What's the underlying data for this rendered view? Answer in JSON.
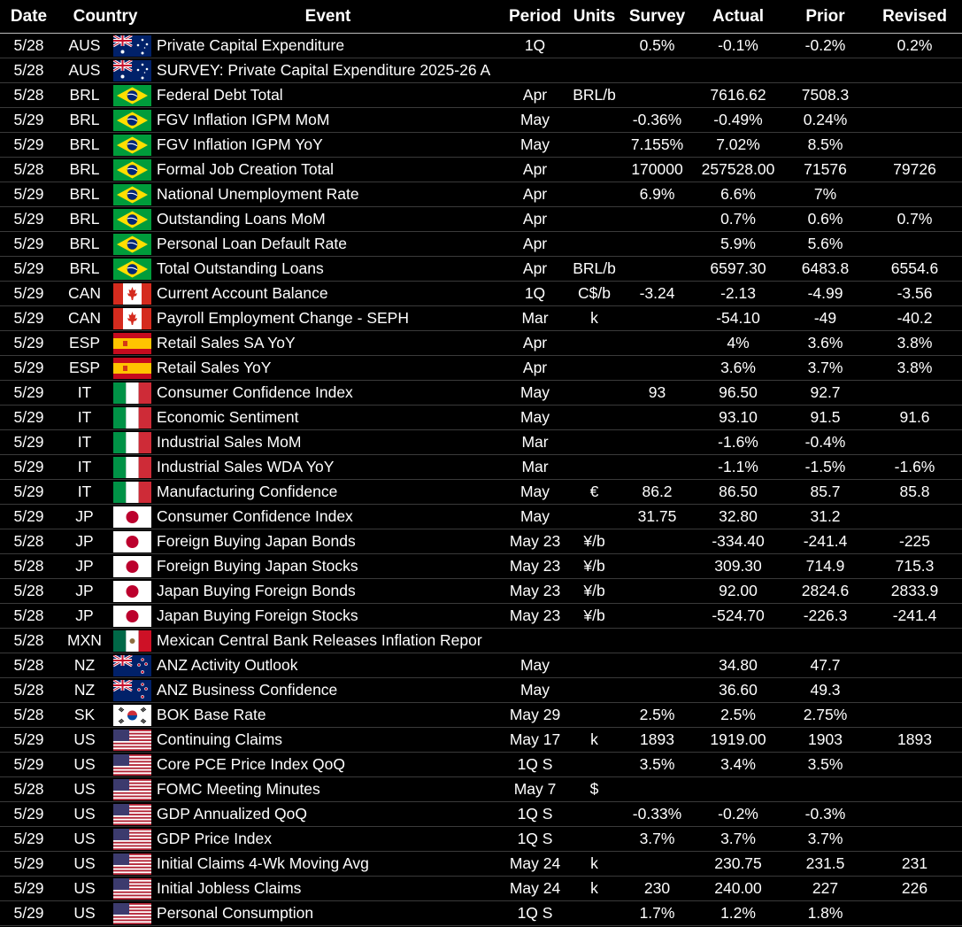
{
  "headers": {
    "date": "Date",
    "country": "Country",
    "event": "Event",
    "period": "Period",
    "units": "Units",
    "survey": "Survey",
    "actual": "Actual",
    "prior": "Prior",
    "revised": "Revised"
  },
  "rows": [
    {
      "date": "5/28",
      "country": "AUS",
      "flag": "aus-flag-icon",
      "event": "Private Capital Expenditure",
      "period": "1Q",
      "units": "",
      "survey": "0.5%",
      "actual": "-0.1%",
      "prior": "-0.2%",
      "revised": "0.2%"
    },
    {
      "date": "5/28",
      "country": "AUS",
      "flag": "aus-flag-icon",
      "event": "SURVEY: Private Capital Expenditure 2025-26 A",
      "period": "",
      "units": "",
      "survey": "",
      "actual": "",
      "prior": "",
      "revised": ""
    },
    {
      "date": "5/28",
      "country": "BRL",
      "flag": "brl-flag-icon",
      "event": "Federal Debt Total",
      "period": "Apr",
      "units": "BRL/b",
      "survey": "",
      "actual": "7616.62",
      "prior": "7508.3",
      "revised": ""
    },
    {
      "date": "5/29",
      "country": "BRL",
      "flag": "brl-flag-icon",
      "event": "FGV Inflation IGPM MoM",
      "period": "May",
      "units": "",
      "survey": "-0.36%",
      "actual": "-0.49%",
      "prior": "0.24%",
      "revised": ""
    },
    {
      "date": "5/29",
      "country": "BRL",
      "flag": "brl-flag-icon",
      "event": "FGV Inflation IGPM YoY",
      "period": "May",
      "units": "",
      "survey": "7.155%",
      "actual": "7.02%",
      "prior": "8.5%",
      "revised": ""
    },
    {
      "date": "5/28",
      "country": "BRL",
      "flag": "brl-flag-icon",
      "event": "Formal Job Creation Total",
      "period": "Apr",
      "units": "",
      "survey": "170000",
      "actual": "257528.00",
      "prior": "71576",
      "revised": "79726"
    },
    {
      "date": "5/29",
      "country": "BRL",
      "flag": "brl-flag-icon",
      "event": "National Unemployment Rate",
      "period": "Apr",
      "units": "",
      "survey": "6.9%",
      "actual": "6.6%",
      "prior": "7%",
      "revised": ""
    },
    {
      "date": "5/29",
      "country": "BRL",
      "flag": "brl-flag-icon",
      "event": "Outstanding Loans MoM",
      "period": "Apr",
      "units": "",
      "survey": "",
      "actual": "0.7%",
      "prior": "0.6%",
      "revised": "0.7%"
    },
    {
      "date": "5/29",
      "country": "BRL",
      "flag": "brl-flag-icon",
      "event": "Personal Loan Default Rate",
      "period": "Apr",
      "units": "",
      "survey": "",
      "actual": "5.9%",
      "prior": "5.6%",
      "revised": ""
    },
    {
      "date": "5/29",
      "country": "BRL",
      "flag": "brl-flag-icon",
      "event": "Total Outstanding Loans",
      "period": "Apr",
      "units": "BRL/b",
      "survey": "",
      "actual": "6597.30",
      "prior": "6483.8",
      "revised": "6554.6"
    },
    {
      "date": "5/29",
      "country": "CAN",
      "flag": "can-flag-icon",
      "event": "Current Account Balance",
      "period": "1Q",
      "units": "C$/b",
      "survey": "-3.24",
      "actual": "-2.13",
      "prior": "-4.99",
      "revised": "-3.56"
    },
    {
      "date": "5/29",
      "country": "CAN",
      "flag": "can-flag-icon",
      "event": "Payroll Employment Change - SEPH",
      "period": "Mar",
      "units": "k",
      "survey": "",
      "actual": "-54.10",
      "prior": "-49",
      "revised": "-40.2"
    },
    {
      "date": "5/29",
      "country": "ESP",
      "flag": "esp-flag-icon",
      "event": "Retail Sales SA YoY",
      "period": "Apr",
      "units": "",
      "survey": "",
      "actual": "4%",
      "prior": "3.6%",
      "revised": "3.8%"
    },
    {
      "date": "5/29",
      "country": "ESP",
      "flag": "esp-flag-icon",
      "event": "Retail Sales YoY",
      "period": "Apr",
      "units": "",
      "survey": "",
      "actual": "3.6%",
      "prior": "3.7%",
      "revised": "3.8%"
    },
    {
      "date": "5/29",
      "country": "IT",
      "flag": "it-flag-icon",
      "event": "Consumer Confidence Index",
      "period": "May",
      "units": "",
      "survey": "93",
      "actual": "96.50",
      "prior": "92.7",
      "revised": ""
    },
    {
      "date": "5/29",
      "country": "IT",
      "flag": "it-flag-icon",
      "event": "Economic Sentiment",
      "period": "May",
      "units": "",
      "survey": "",
      "actual": "93.10",
      "prior": "91.5",
      "revised": "91.6"
    },
    {
      "date": "5/29",
      "country": "IT",
      "flag": "it-flag-icon",
      "event": "Industrial Sales MoM",
      "period": "Mar",
      "units": "",
      "survey": "",
      "actual": "-1.6%",
      "prior": "-0.4%",
      "revised": ""
    },
    {
      "date": "5/29",
      "country": "IT",
      "flag": "it-flag-icon",
      "event": "Industrial Sales WDA YoY",
      "period": "Mar",
      "units": "",
      "survey": "",
      "actual": "-1.1%",
      "prior": "-1.5%",
      "revised": "-1.6%"
    },
    {
      "date": "5/29",
      "country": "IT",
      "flag": "it-flag-icon",
      "event": "Manufacturing Confidence",
      "period": "May",
      "units": "€",
      "survey": "86.2",
      "actual": "86.50",
      "prior": "85.7",
      "revised": "85.8"
    },
    {
      "date": "5/29",
      "country": "JP",
      "flag": "jp-flag-icon",
      "event": "Consumer Confidence Index",
      "period": "May",
      "units": "",
      "survey": "31.75",
      "actual": "32.80",
      "prior": "31.2",
      "revised": ""
    },
    {
      "date": "5/28",
      "country": "JP",
      "flag": "jp-flag-icon",
      "event": "Foreign Buying Japan Bonds",
      "period": "May 23",
      "units": "¥/b",
      "survey": "",
      "actual": "-334.40",
      "prior": "-241.4",
      "revised": "-225"
    },
    {
      "date": "5/28",
      "country": "JP",
      "flag": "jp-flag-icon",
      "event": "Foreign Buying Japan Stocks",
      "period": "May 23",
      "units": "¥/b",
      "survey": "",
      "actual": "309.30",
      "prior": "714.9",
      "revised": "715.3"
    },
    {
      "date": "5/28",
      "country": "JP",
      "flag": "jp-flag-icon",
      "event": "Japan Buying Foreign Bonds",
      "period": "May 23",
      "units": "¥/b",
      "survey": "",
      "actual": "92.00",
      "prior": "2824.6",
      "revised": "2833.9"
    },
    {
      "date": "5/28",
      "country": "JP",
      "flag": "jp-flag-icon",
      "event": "Japan Buying Foreign Stocks",
      "period": "May 23",
      "units": "¥/b",
      "survey": "",
      "actual": "-524.70",
      "prior": "-226.3",
      "revised": "-241.4"
    },
    {
      "date": "5/28",
      "country": "MXN",
      "flag": "mxn-flag-icon",
      "event": "Mexican Central Bank Releases Inflation Repor",
      "period": "",
      "units": "",
      "survey": "",
      "actual": "",
      "prior": "",
      "revised": ""
    },
    {
      "date": "5/28",
      "country": "NZ",
      "flag": "nz-flag-icon",
      "event": "ANZ Activity Outlook",
      "period": "May",
      "units": "",
      "survey": "",
      "actual": "34.80",
      "prior": "47.7",
      "revised": ""
    },
    {
      "date": "5/28",
      "country": "NZ",
      "flag": "nz-flag-icon",
      "event": "ANZ Business Confidence",
      "period": "May",
      "units": "",
      "survey": "",
      "actual": "36.60",
      "prior": "49.3",
      "revised": ""
    },
    {
      "date": "5/28",
      "country": "SK",
      "flag": "sk-flag-icon",
      "event": "BOK Base Rate",
      "period": "May 29",
      "units": "",
      "survey": "2.5%",
      "actual": "2.5%",
      "prior": "2.75%",
      "revised": ""
    },
    {
      "date": "5/29",
      "country": "US",
      "flag": "us-flag-icon",
      "event": "Continuing Claims",
      "period": "May 17",
      "units": "k",
      "survey": "1893",
      "actual": "1919.00",
      "prior": "1903",
      "revised": "1893"
    },
    {
      "date": "5/29",
      "country": "US",
      "flag": "us-flag-icon",
      "event": "Core PCE Price Index QoQ",
      "period": "1Q S",
      "units": "",
      "survey": "3.5%",
      "actual": "3.4%",
      "prior": "3.5%",
      "revised": ""
    },
    {
      "date": "5/28",
      "country": "US",
      "flag": "us-flag-icon",
      "event": "FOMC Meeting Minutes",
      "period": "May 7",
      "units": "$",
      "survey": "",
      "actual": "",
      "prior": "",
      "revised": ""
    },
    {
      "date": "5/29",
      "country": "US",
      "flag": "us-flag-icon",
      "event": "GDP Annualized QoQ",
      "period": "1Q S",
      "units": "",
      "survey": "-0.33%",
      "actual": "-0.2%",
      "prior": "-0.3%",
      "revised": ""
    },
    {
      "date": "5/29",
      "country": "US",
      "flag": "us-flag-icon",
      "event": "GDP Price Index",
      "period": "1Q S",
      "units": "",
      "survey": "3.7%",
      "actual": "3.7%",
      "prior": "3.7%",
      "revised": ""
    },
    {
      "date": "5/29",
      "country": "US",
      "flag": "us-flag-icon",
      "event": "Initial Claims 4-Wk Moving Avg",
      "period": "May 24",
      "units": "k",
      "survey": "",
      "actual": "230.75",
      "prior": "231.5",
      "revised": "231"
    },
    {
      "date": "5/29",
      "country": "US",
      "flag": "us-flag-icon",
      "event": "Initial Jobless Claims",
      "period": "May 24",
      "units": "k",
      "survey": "230",
      "actual": "240.00",
      "prior": "227",
      "revised": "226"
    },
    {
      "date": "5/29",
      "country": "US",
      "flag": "us-flag-icon",
      "event": "Personal Consumption",
      "period": "1Q S",
      "units": "",
      "survey": "1.7%",
      "actual": "1.2%",
      "prior": "1.8%",
      "revised": ""
    }
  ],
  "colors": {
    "background": "#000000",
    "text": "#ffffff"
  }
}
